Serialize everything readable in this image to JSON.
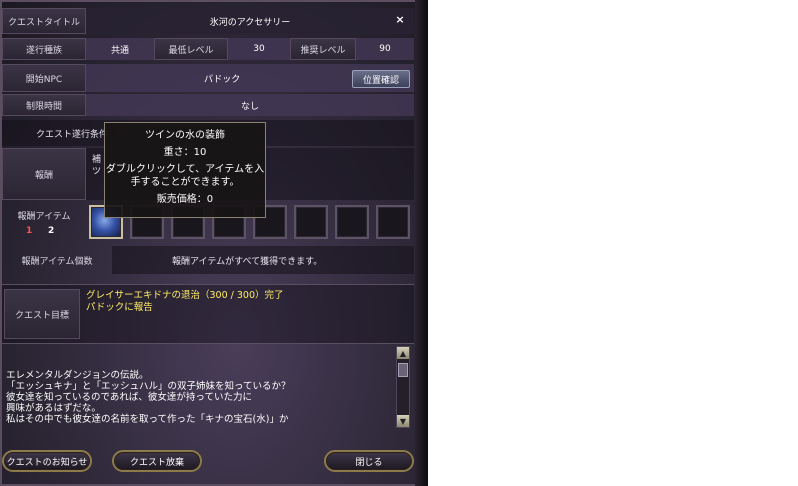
{
  "header": {
    "title_label": "クエストタイトル",
    "title_value": "氷河のアクセサリー",
    "close": "×"
  },
  "info": {
    "type_label": "遂行種族",
    "type_value": "共通",
    "min_level_label": "最低レベル",
    "min_level_value": "30",
    "rec_level_label": "推奨レベル",
    "rec_level_value": "90"
  },
  "npc": {
    "label": "開始NPC",
    "value": "パドック",
    "locate_button": "位置確認"
  },
  "time_limit": {
    "label": "制限時間",
    "value": "なし"
  },
  "conditions": {
    "label": "クエスト遂行条件"
  },
  "reward": {
    "label": "報酬",
    "text_partial_1": "補",
    "text_partial_2": "ツ"
  },
  "reward_items": {
    "label": "報酬アイテム",
    "page_1": "1",
    "page_2": "2",
    "item_icon": "frost-accessory-icon"
  },
  "reward_count": {
    "label": "報酬アイテム個数",
    "value": "報酬アイテムがすべて獲得できます。"
  },
  "tooltip": {
    "name": "ツインの水の装飾",
    "weight": "重さ：10",
    "desc_1": "ダブルクリックして、アイテムを入",
    "desc_2": "手することができます。",
    "price": "販売価格：0"
  },
  "objective": {
    "label": "クエスト目標",
    "line_1": "グレイサーエキドナの退治（300 / 300）完了",
    "line_2": "パドックに報告"
  },
  "story": [
    "エレメンタルダンジョンの伝説。",
    "「エッシュキナ」と「エッシュハル」の双子姉妹を知っているか？",
    "彼女達を知っているのであれば、彼女達が持っていた力に",
    "興味があるはずだな。",
    "私はその中でも彼女達の名前を取って作った「キナの宝石(水)」か"
  ],
  "buttons": {
    "notice": "クエストのお知らせ",
    "abandon": "クエスト放棄",
    "close": "閉じる"
  },
  "colors": {
    "objective_text": "#ffee66",
    "panel_bg": "#2e2838"
  }
}
